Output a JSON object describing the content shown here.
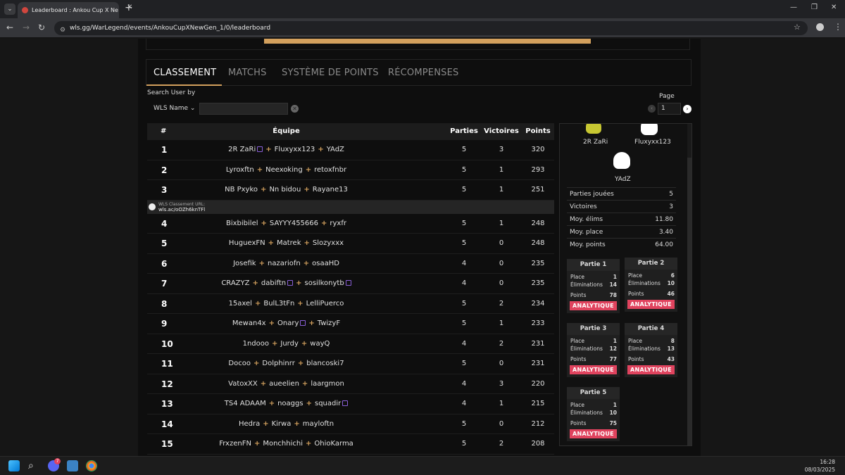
{
  "browser": {
    "tab_title": "Leaderboard : Ankou Cup X Ne",
    "url": "wls.gg/WarLegend/events/AnkouCupXNewGen_1/0/leaderboard"
  },
  "nav_tabs": [
    "CLASSEMENT",
    "MATCHS",
    "SYSTÈME DE POINTS",
    "RÉCOMPENSES"
  ],
  "search": {
    "label": "Search User by",
    "select_value": "WLS Name",
    "input_value": ""
  },
  "pagination": {
    "label": "Page",
    "value": "1"
  },
  "table": {
    "headers": {
      "rank": "#",
      "team": "Équipe",
      "parties": "Parties",
      "victoires": "Victoires",
      "points": "Points"
    },
    "rows": [
      {
        "rank": "1",
        "players": [
          "2R ZaRi",
          "Fluxyxx123",
          "YAdZ"
        ],
        "parties": "5",
        "victoires": "3",
        "points": "320"
      },
      {
        "rank": "2",
        "players": [
          "Lyroxftn",
          "Neexoking",
          "retoxfnbr"
        ],
        "parties": "5",
        "victoires": "1",
        "points": "293"
      },
      {
        "rank": "3",
        "players": [
          "NB Pxyko",
          "Nn bidou",
          "Rayane13"
        ],
        "parties": "5",
        "victoires": "1",
        "points": "251"
      },
      {
        "rank": "4",
        "players": [
          "Bixbibilel",
          "SAYYY455666",
          "ryxfr"
        ],
        "parties": "5",
        "victoires": "1",
        "points": "248"
      },
      {
        "rank": "5",
        "players": [
          "HuguexFN",
          "Matrek",
          "Slozyxxx"
        ],
        "parties": "5",
        "victoires": "0",
        "points": "248"
      },
      {
        "rank": "6",
        "players": [
          "Josefik",
          "nazariofn",
          "osaaHD"
        ],
        "parties": "4",
        "victoires": "0",
        "points": "235"
      },
      {
        "rank": "7",
        "players": [
          "CRAZYZ",
          "dabiftn",
          "sosilkonytb"
        ],
        "parties": "4",
        "victoires": "0",
        "points": "235"
      },
      {
        "rank": "8",
        "players": [
          "15axel",
          "BulL3tFn",
          "LelliPuerco"
        ],
        "parties": "5",
        "victoires": "2",
        "points": "234"
      },
      {
        "rank": "9",
        "players": [
          "Mewan4x",
          "Onary",
          "TwizyF"
        ],
        "parties": "5",
        "victoires": "1",
        "points": "233"
      },
      {
        "rank": "10",
        "players": [
          "1ndooo",
          "Jurdy",
          "wayQ"
        ],
        "parties": "4",
        "victoires": "2",
        "points": "231"
      },
      {
        "rank": "11",
        "players": [
          "Docoo",
          "Dolphinrr",
          "blancoski7"
        ],
        "parties": "5",
        "victoires": "0",
        "points": "231"
      },
      {
        "rank": "12",
        "players": [
          "VatoxXX",
          "aueelien",
          "laargmon"
        ],
        "parties": "4",
        "victoires": "3",
        "points": "220"
      },
      {
        "rank": "13",
        "players": [
          "TS4 ADAAM",
          "noaggs",
          "squadir"
        ],
        "parties": "4",
        "victoires": "1",
        "points": "215"
      },
      {
        "rank": "14",
        "players": [
          "Hedra",
          "Kirwa",
          "mayloftn"
        ],
        "parties": "5",
        "victoires": "0",
        "points": "212"
      },
      {
        "rank": "15",
        "players": [
          "FrxzenFN",
          "Monchhichi",
          "OhioKarma"
        ],
        "parties": "5",
        "victoires": "2",
        "points": "208"
      }
    ],
    "wls_url": {
      "label": "WLS Classement URL:",
      "value": "wls.ac/oOZh6knTFl"
    }
  },
  "detail": {
    "players": [
      "2R ZaRi",
      "Fluxyxx123",
      "YAdZ"
    ],
    "stats": [
      {
        "label": "Parties jouées",
        "value": "5"
      },
      {
        "label": "Victoires",
        "value": "3"
      },
      {
        "label": "Moy. élims",
        "value": "11.80"
      },
      {
        "label": "Moy. place",
        "value": "3.40"
      },
      {
        "label": "Moy. points",
        "value": "64.00"
      }
    ],
    "labels": {
      "place": "Place",
      "elims": "Éliminations",
      "points": "Points",
      "analytics": "ANALYTIQUE"
    },
    "games": [
      {
        "title": "Partie 1",
        "place": "1",
        "elims": "14",
        "points": "78"
      },
      {
        "title": "Partie 2",
        "place": "6",
        "elims": "10",
        "points": "46"
      },
      {
        "title": "Partie 3",
        "place": "1",
        "elims": "12",
        "points": "77"
      },
      {
        "title": "Partie 4",
        "place": "8",
        "elims": "13",
        "points": "43"
      },
      {
        "title": "Partie 5",
        "place": "1",
        "elims": "10",
        "points": "75"
      }
    ]
  },
  "taskbar": {
    "time": "16:28",
    "date": "08/03/2025",
    "discord_badge": "7"
  },
  "colors": {
    "accent": "#d3a05d",
    "analytics": "#e0435e",
    "twitch": "#8a60d8"
  }
}
